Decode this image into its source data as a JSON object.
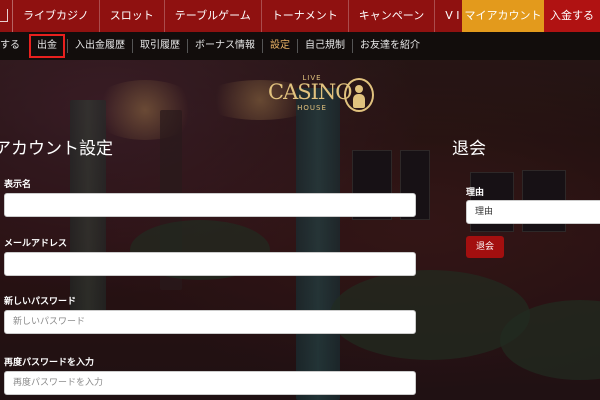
{
  "top_nav": {
    "items": [
      {
        "label": "ライブカジノ"
      },
      {
        "label": "スロット"
      },
      {
        "label": "テーブルゲーム"
      },
      {
        "label": "トーナメント"
      },
      {
        "label": "キャンペーン"
      },
      {
        "label": "V I P"
      }
    ],
    "my_account_label": "マイアカウント",
    "deposit_label": "入金する"
  },
  "sub_nav": {
    "items": [
      {
        "label": "する"
      },
      {
        "label": "出金"
      },
      {
        "label": "入出金履歴"
      },
      {
        "label": "取引履歴"
      },
      {
        "label": "ボーナス情報"
      },
      {
        "label": "設定"
      },
      {
        "label": "自己規制"
      },
      {
        "label": "お友達を紹介"
      }
    ],
    "active_item": "設定",
    "highlighted_item": "出金"
  },
  "logo": {
    "live": "LIVE",
    "casino": "CASINO",
    "house": "HOUSE"
  },
  "account_settings": {
    "title": "アカウント設定",
    "display_name_label": "表示名",
    "display_name_value": "",
    "email_label": "メールアドレス",
    "email_value": "",
    "new_password_label": "新しいパスワード",
    "new_password_placeholder": "新しいパスワード",
    "confirm_password_label": "再度パスワードを入力",
    "confirm_password_placeholder": "再度パスワードを入力"
  },
  "withdrawal": {
    "title": "退会",
    "reason_label": "理由",
    "reason_selected": "理由",
    "button_label": "退会"
  },
  "colors": {
    "top_nav_bg": "#8f1110",
    "my_account_bg": "#e39a1c",
    "deposit_bg": "#b01212",
    "highlight_border": "#e8201e",
    "logo_gold": "#e1c27e"
  }
}
